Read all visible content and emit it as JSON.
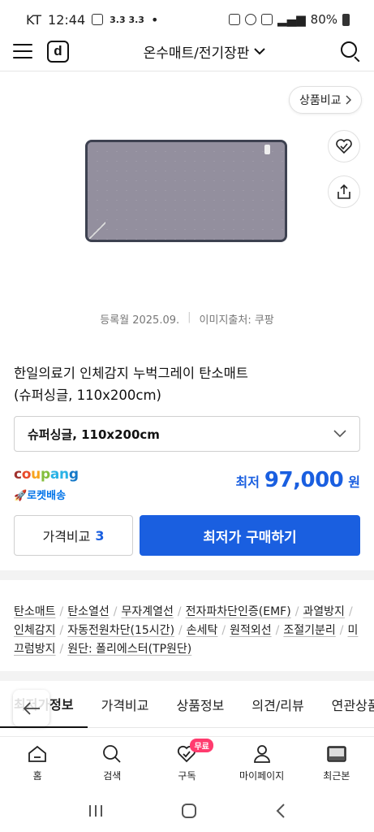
{
  "status_bar": {
    "carrier": "KT",
    "time": "12:44",
    "extra": "3.3 3.3",
    "battery": "80%"
  },
  "header": {
    "category": "온수매트/전기장판"
  },
  "compare_link": {
    "label": "상품비교"
  },
  "image_meta": {
    "registered": "등록월 2025.09.",
    "source": "이미지출처: 쿠팡"
  },
  "product": {
    "title_line1": "한일의료기 인체감지 누벅그레이 탄소매트",
    "title_line2": "(슈퍼싱글, 110x200cm)",
    "selected_option": "슈퍼싱글, 110x200cm"
  },
  "seller": {
    "name": "coupang",
    "delivery": "🚀로켓배송"
  },
  "price": {
    "label": "최저",
    "value": "97,000",
    "unit": "원"
  },
  "actions": {
    "compare_label": "가격비교",
    "compare_count": "3",
    "buy_label": "최저가 구매하기"
  },
  "tags": [
    "탄소매트",
    "탄소열선",
    "무자계열선",
    "전자파차단인증(EMF)",
    "과열방지",
    "인체감지",
    "자동전원차단(15시간)",
    "손세탁",
    "원적외선",
    "조절기분리",
    "미끄럼방지",
    "원단: 폴리에스터(TP원단)"
  ],
  "tabs": [
    "최저가정보",
    "가격비교",
    "상품정보",
    "의견/리뷰",
    "연관상품"
  ],
  "bottom_nav": [
    {
      "label": "홈",
      "icon": "home-icon"
    },
    {
      "label": "검색",
      "icon": "search-icon"
    },
    {
      "label": "구독",
      "icon": "subscribe-heart-icon",
      "badge": "무료"
    },
    {
      "label": "마이페이지",
      "icon": "person-icon"
    },
    {
      "label": "최근본",
      "icon": "recent-icon"
    }
  ]
}
